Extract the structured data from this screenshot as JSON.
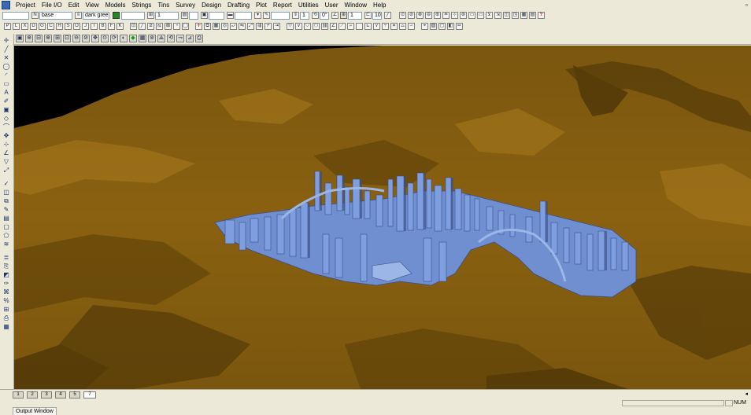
{
  "menu": [
    {
      "label": "Project",
      "ul": "P"
    },
    {
      "label": "File I/O",
      "ul": "F"
    },
    {
      "label": "Edit",
      "ul": "E"
    },
    {
      "label": "View",
      "ul": "V"
    },
    {
      "label": "Models",
      "ul": "M"
    },
    {
      "label": "Strings",
      "ul": "S"
    },
    {
      "label": "Tins",
      "ul": "T"
    },
    {
      "label": "Survey",
      "ul": "S"
    },
    {
      "label": "Design",
      "ul": "D"
    },
    {
      "label": "Drafting",
      "ul": "D"
    },
    {
      "label": "Plot",
      "ul": "P"
    },
    {
      "label": "Report",
      "ul": "R"
    },
    {
      "label": "Utilities",
      "ul": "U"
    },
    {
      "label": "User",
      "ul": "U"
    },
    {
      "label": "Window",
      "ul": "W"
    },
    {
      "label": "Help",
      "ul": "H"
    }
  ],
  "toolbar": {
    "model_value": "base",
    "colour_value": "dark green",
    "colour_swatch": "#1f8a1f",
    "line_weight_value": "1",
    "count_value": "1",
    "angle_value": "0°",
    "step_value": "1",
    "max_value": "10"
  },
  "toolbar2_letters": [
    "P",
    "L",
    "X",
    "D",
    "G",
    "C",
    "H",
    "S",
    "O",
    "J",
    "I",
    "B",
    "F",
    "K"
  ],
  "tabs": [
    {
      "label": "1"
    },
    {
      "label": "2"
    },
    {
      "label": "3"
    },
    {
      "label": "4"
    },
    {
      "label": "5"
    },
    {
      "label": "7"
    }
  ],
  "status": {
    "num_indicator": "NUM",
    "output_window_label": "Output Window"
  },
  "viewport": {
    "terrain_color": "#8a6110",
    "terrain_light": "#a97a1e",
    "terrain_dark": "#4a3306",
    "sky_color": "#000000",
    "building_color": "#6f8fd0",
    "building_light": "#9db6e8",
    "building_dark": "#3b4f86"
  }
}
